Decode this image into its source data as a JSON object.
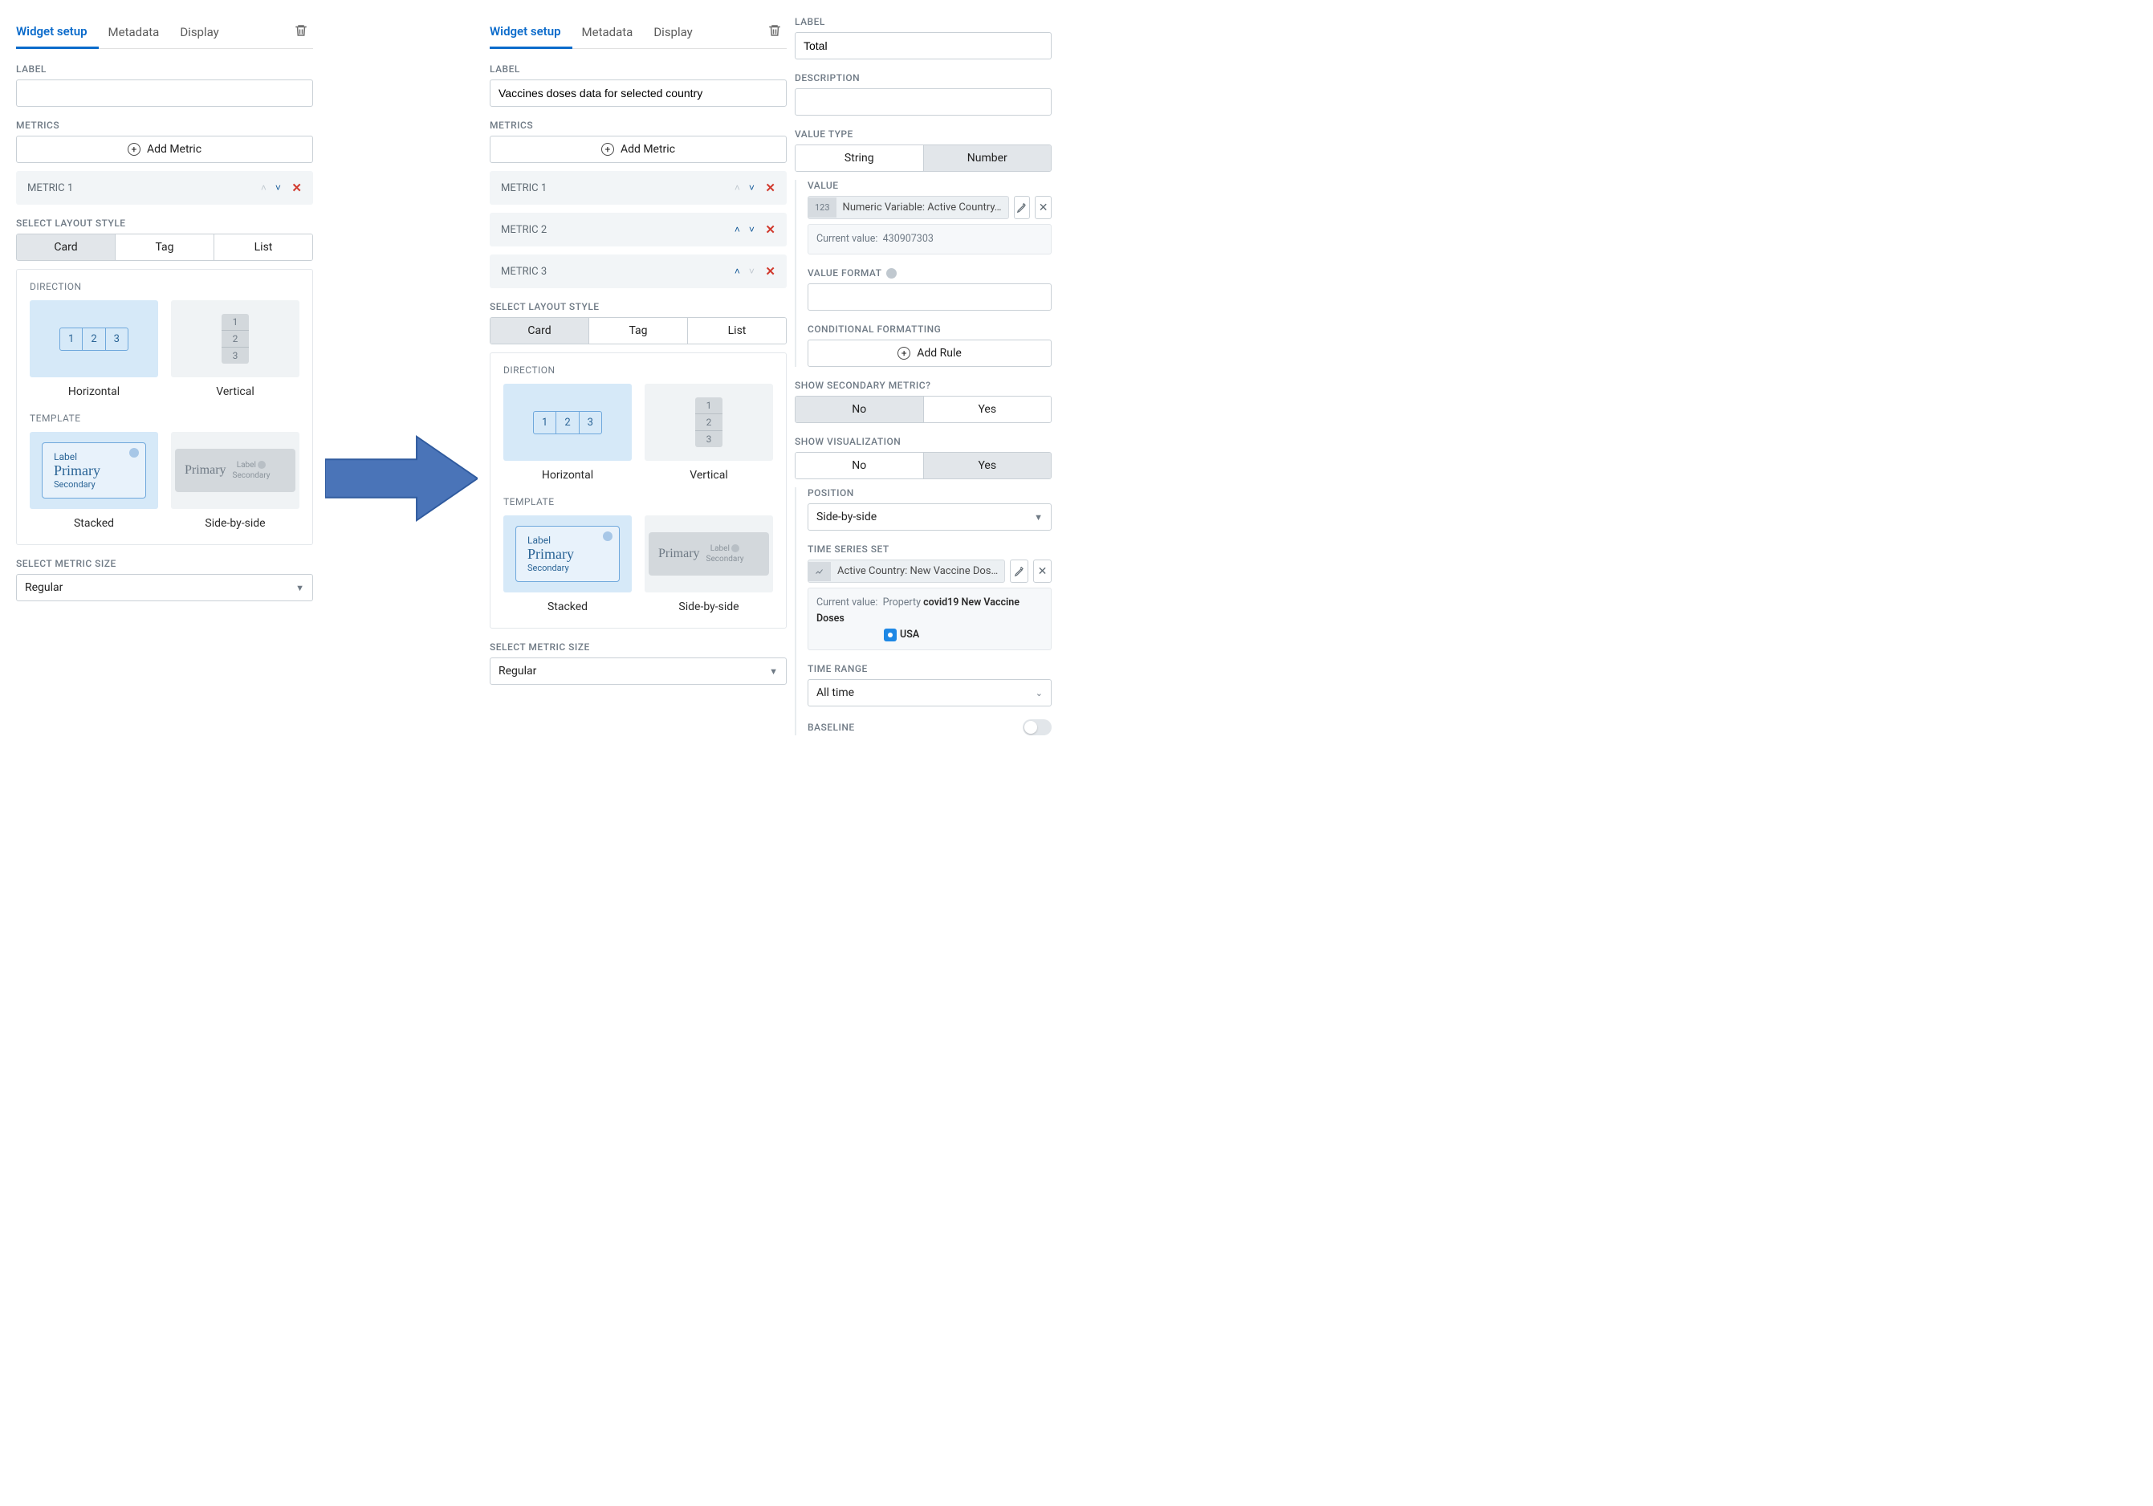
{
  "tabs": {
    "widget_setup": "Widget setup",
    "metadata": "Metadata",
    "display": "Display"
  },
  "labels": {
    "label": "LABEL",
    "metrics": "METRICS",
    "select_layout": "SELECT LAYOUT STYLE",
    "direction": "DIRECTION",
    "template": "TEMPLATE",
    "select_metric_size": "SELECT METRIC SIZE",
    "description": "DESCRIPTION",
    "value_type": "VALUE TYPE",
    "value": "VALUE",
    "value_format": "VALUE FORMAT",
    "cond_fmt": "CONDITIONAL FORMATTING",
    "show_secondary": "SHOW SECONDARY METRIC?",
    "show_viz": "SHOW VISUALIZATION",
    "position": "POSITION",
    "tss": "TIME SERIES SET",
    "time_range": "TIME RANGE",
    "baseline": "BASELINE"
  },
  "buttons": {
    "add_metric": "Add Metric",
    "add_rule": "Add Rule"
  },
  "layout_opts": {
    "card": "Card",
    "tag": "Tag",
    "list": "List"
  },
  "direction_opts": {
    "horizontal": "Horizontal",
    "vertical": "Vertical"
  },
  "template_opts": {
    "stacked": "Stacked",
    "side": "Side-by-side",
    "preview": {
      "label": "Label",
      "primary": "Primary",
      "secondary": "Secondary"
    }
  },
  "metric_size": "Regular",
  "left": {
    "label_value": "",
    "metric_rows": [
      "METRIC 1"
    ]
  },
  "mid": {
    "label_value": "Vaccines doses data for selected country",
    "metric_rows": [
      "METRIC 1",
      "METRIC 2",
      "METRIC 3"
    ]
  },
  "right": {
    "label_value": "Total",
    "desc_value": "",
    "value_type": {
      "string": "String",
      "number": "Number"
    },
    "value_chip": "Numeric Variable: Active Country…",
    "current_value_label": "Current value:",
    "current_value": "430907303",
    "value_format": "",
    "secondary": {
      "no": "No",
      "yes": "Yes"
    },
    "viz": {
      "no": "No",
      "yes": "Yes"
    },
    "position": "Side-by-side",
    "tss_chip": "Active Country: New Vaccine Dos…",
    "tss_cv_line1a": "Property ",
    "tss_cv_line1b": "covid19 New Vaccine Doses",
    "tss_cv_line2": "USA",
    "time_range": "All time"
  }
}
